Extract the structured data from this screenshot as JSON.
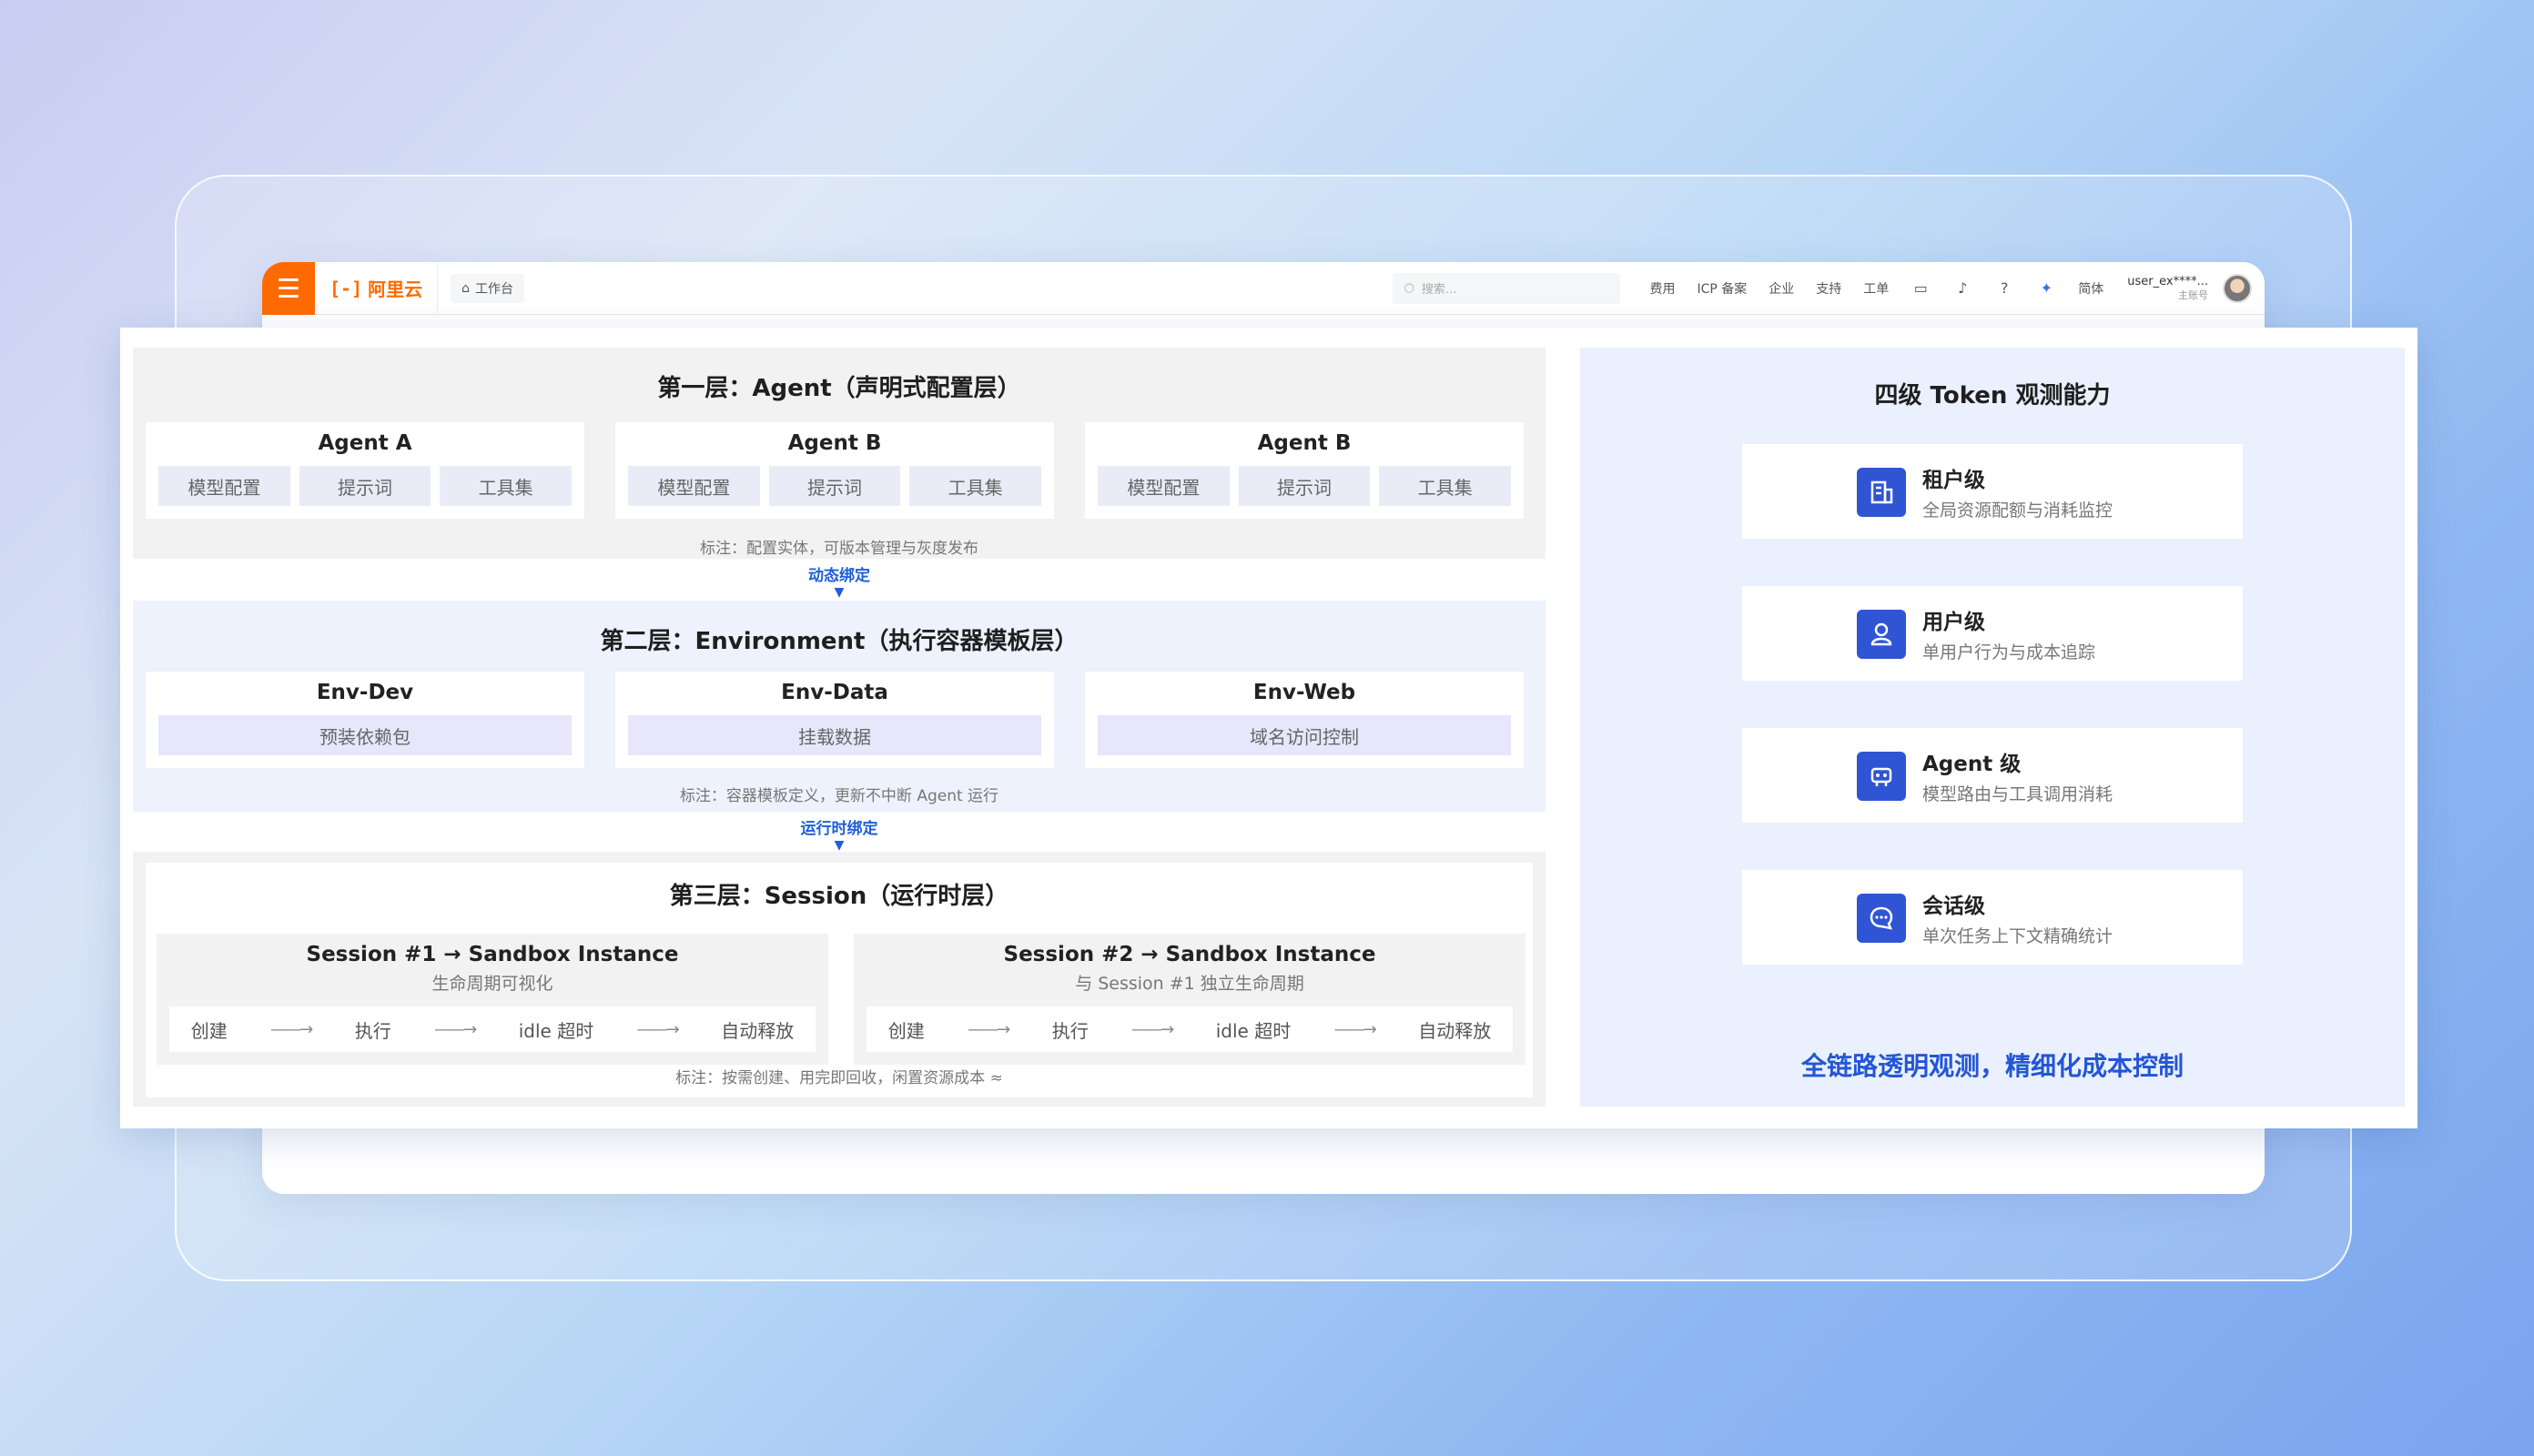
{
  "topbar": {
    "logo_text": "阿里云",
    "logo_mark": "[-]",
    "workbench_label": "工作台",
    "search_placeholder": "搜索...",
    "nav_links": [
      "费用",
      "ICP 备案",
      "企业",
      "支持",
      "工单"
    ],
    "lang_label": "简体",
    "user_name": "user_ex****...",
    "user_role": "主账号"
  },
  "layer1": {
    "title": "第一层：Agent（声明式配置层）",
    "boxes": [
      {
        "title": "Agent A",
        "chips": [
          "模型配置",
          "提示词",
          "工具集"
        ]
      },
      {
        "title": "Agent B",
        "chips": [
          "模型配置",
          "提示词",
          "工具集"
        ]
      },
      {
        "title": "Agent B",
        "chips": [
          "模型配置",
          "提示词",
          "工具集"
        ]
      }
    ],
    "note": "标注：配置实体，可版本管理与灰度发布"
  },
  "binding1": {
    "label": "动态绑定",
    "arrow": "▼"
  },
  "layer2": {
    "title": "第二层：Environment（执行容器模板层）",
    "boxes": [
      {
        "title": "Env-Dev",
        "chip": "预装依赖包"
      },
      {
        "title": "Env-Data",
        "chip": "挂载数据"
      },
      {
        "title": "Env-Web",
        "chip": "域名访问控制"
      }
    ],
    "note": "标注：容器模板定义，更新不中断 Agent 运行"
  },
  "binding2": {
    "label": "运行时绑定",
    "arrow": "▼"
  },
  "layer3": {
    "title": "第三层：Session（运行时层）",
    "sessions": [
      {
        "title": "Session #1 → Sandbox Instance",
        "subtitle": "生命周期可视化",
        "steps": [
          "创建",
          "执行",
          "idle 超时",
          "自动释放"
        ]
      },
      {
        "title": "Session #2 → Sandbox Instance",
        "subtitle": "与 Session #1 独立生命周期",
        "steps": [
          "创建",
          "执行",
          "idle 超时",
          "自动释放"
        ]
      }
    ],
    "flow_arrow": "——→",
    "note": "标注：按需创建、用完即回收，闲置资源成本 ≈"
  },
  "right_panel": {
    "title": "四级 Token 观测能力",
    "metrics": [
      {
        "name": "租户级",
        "desc": "全局资源配额与消耗监控",
        "icon": "building-icon"
      },
      {
        "name": "用户级",
        "desc": "单用户行为与成本追踪",
        "icon": "user-icon"
      },
      {
        "name": "Agent 级",
        "desc": "模型路由与工具调用消耗",
        "icon": "robot-icon"
      },
      {
        "name": "会话级",
        "desc": "单次任务上下文精确统计",
        "icon": "chat-icon"
      }
    ],
    "footer": "全链路透明观测，精细化成本控制"
  },
  "colors": {
    "brand": "#ff6a00",
    "accent": "#2f55d4",
    "footer": "#2356d6"
  }
}
